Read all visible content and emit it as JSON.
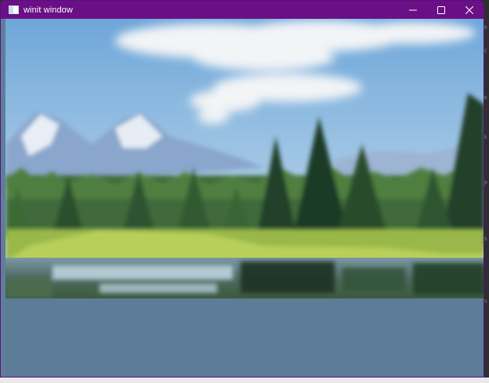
{
  "window": {
    "title": "winit window",
    "icon": "app-window-icon"
  },
  "caption_buttons": {
    "minimize": "minimize-icon",
    "maximize": "maximize-icon",
    "close": "close-icon"
  },
  "colors": {
    "titlebar": "#6a0f86",
    "client_background": "#5d7c97"
  }
}
